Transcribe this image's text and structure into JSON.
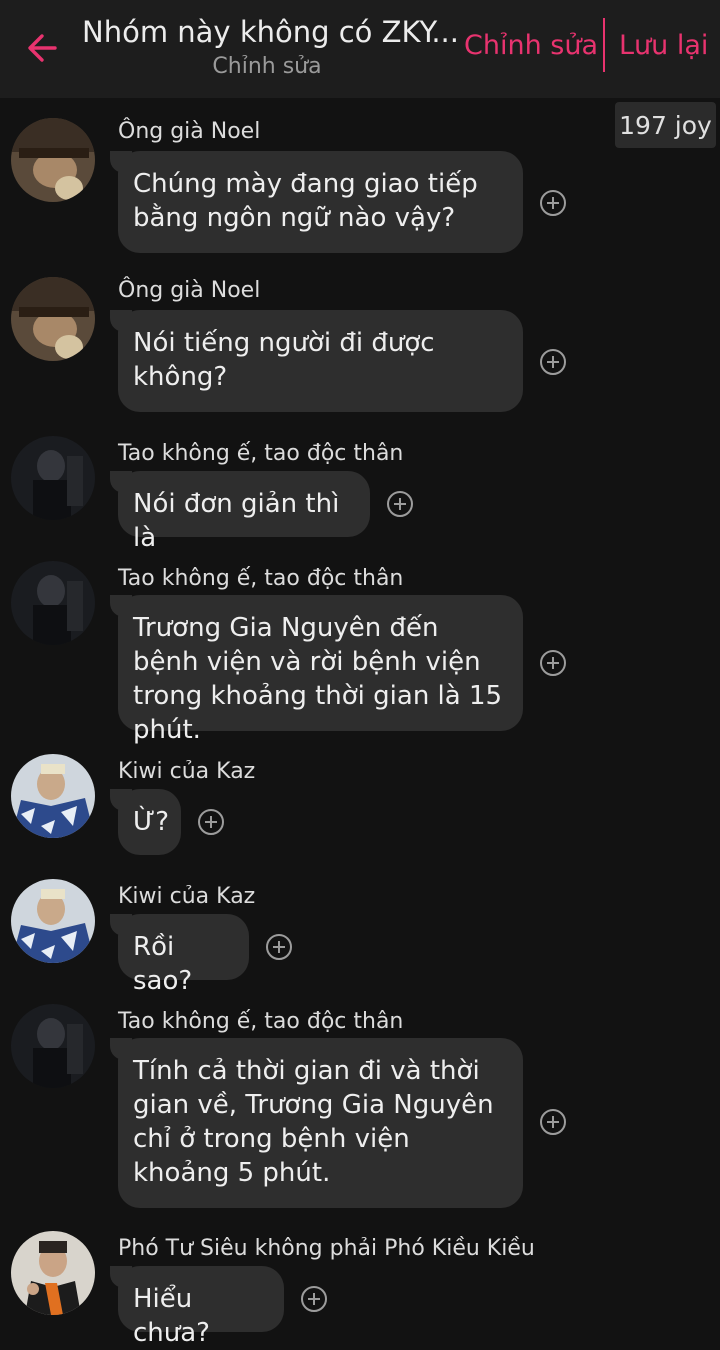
{
  "header": {
    "title": "Nhóm này không có ZKY...",
    "subtitle": "Chỉnh sửa",
    "edit_label": "Chỉnh sửa",
    "save_label": "Lưu lại",
    "accent_color": "#e8336f"
  },
  "joy_badge": "197 joy",
  "messages": [
    {
      "sender": "Ông già Noel",
      "text": "Chúng mày đang giao tiếp bằng ngôn ngữ nào vậy?",
      "avatar": "avatar-noel"
    },
    {
      "sender": "Ông già Noel",
      "text": "Nói tiếng người đi được không?",
      "avatar": "avatar-noel"
    },
    {
      "sender": "Tao không ế, tao độc thân",
      "text": "Nói đơn giản thì là",
      "avatar": "avatar-dark"
    },
    {
      "sender": "Tao không ế, tao độc thân",
      "text": "Trương Gia Nguyên đến bệnh viện và rời bệnh viện trong khoảng thời gian là 15 phút.",
      "avatar": "avatar-dark"
    },
    {
      "sender": "Kiwi của Kaz",
      "text": "Ừ?",
      "avatar": "avatar-kiwi"
    },
    {
      "sender": "Kiwi của Kaz",
      "text": "Rồi sao?",
      "avatar": "avatar-kiwi"
    },
    {
      "sender": "Tao không ế, tao độc thân",
      "text": "Tính cả thời gian đi và thời gian về, Trương Gia Nguyên chỉ ở trong bệnh viện khoảng 5 phút.",
      "avatar": "avatar-dark"
    },
    {
      "sender": "Phó Tư Siêu không phải Phó Kiều Kiều",
      "text": "Hiểu chưa?",
      "avatar": "avatar-pho"
    }
  ]
}
